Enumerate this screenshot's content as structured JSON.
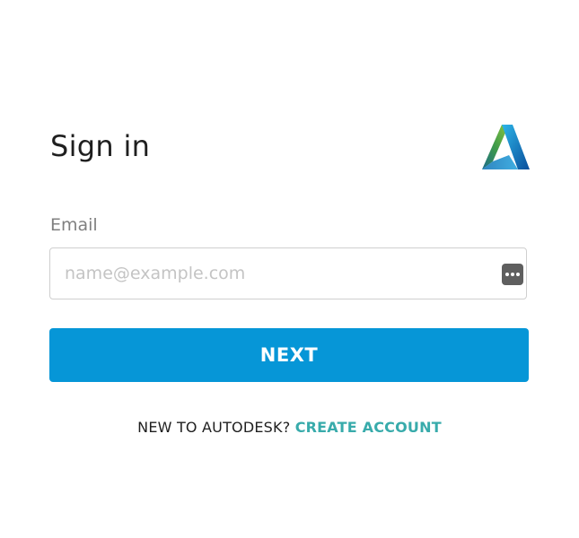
{
  "header": {
    "title": "Sign in",
    "logo_icon": "autodesk-logo-icon"
  },
  "form": {
    "email_label": "Email",
    "email_value": "",
    "email_placeholder": "name@example.com",
    "autofill_icon": "password-manager-icon",
    "next_label": "NEXT"
  },
  "footer": {
    "prompt": "NEW TO AUTODESK?",
    "create_account_label": "CREATE ACCOUNT"
  },
  "colors": {
    "primary_button": "#0696d7",
    "link": "#38abab",
    "label": "#808080",
    "placeholder": "#c4c4c4"
  }
}
